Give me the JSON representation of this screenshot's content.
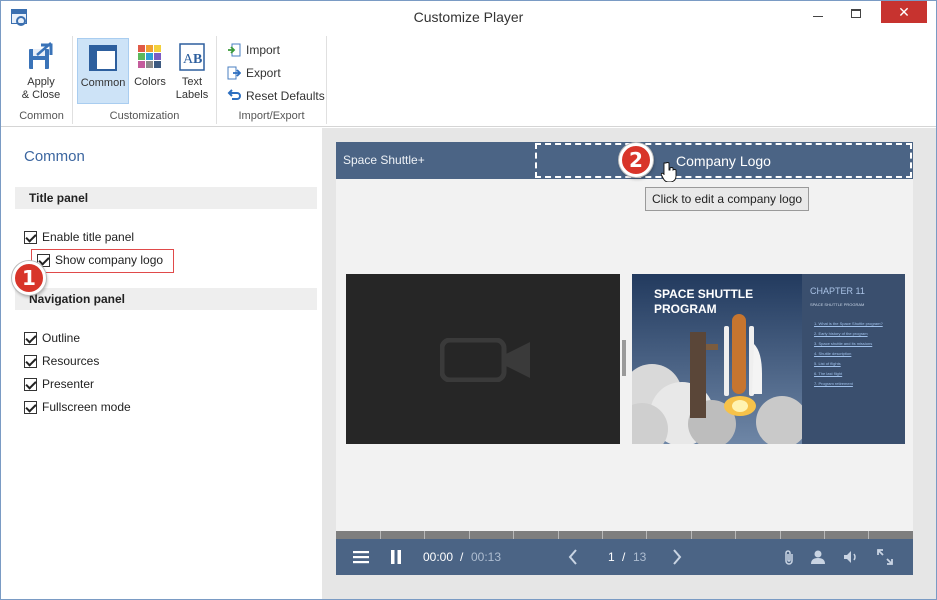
{
  "window": {
    "title": "Customize Player"
  },
  "ribbon": {
    "groups": [
      {
        "label": "Common"
      },
      {
        "label": "Customization"
      },
      {
        "label": "Import/Export"
      }
    ],
    "apply_close": {
      "line1": "Apply",
      "line2": "& Close"
    },
    "common": {
      "label": "Common"
    },
    "colors": {
      "label": "Colors"
    },
    "text_labels": {
      "line1": "Text",
      "line2": "Labels"
    },
    "import": {
      "label": "Import"
    },
    "export": {
      "label": "Export"
    },
    "reset": {
      "label": "Reset Defaults"
    }
  },
  "left": {
    "title": "Common",
    "title_panel": {
      "header": "Title panel",
      "enable": "Enable title panel",
      "show_logo": "Show company logo"
    },
    "navigation_panel": {
      "header": "Navigation panel",
      "items": [
        "Outline",
        "Resources",
        "Presenter",
        "Fullscreen mode"
      ]
    },
    "badge1": "1"
  },
  "preview": {
    "course_title": "Space Shuttle+",
    "logo_text": "Company Logo",
    "tooltip": "Click to edit a company logo",
    "badge2": "2",
    "slide": {
      "heading_line1": "SPACE SHUTTLE",
      "heading_line2": "PROGRAM",
      "chapter": "CHAPTER 11",
      "chapter_sub": "SPACE SHUTTLE PROGRAM",
      "links": [
        "1. What is the Space Shuttle program?",
        "2. Early history of the program",
        "3. Space shuttle and its missions",
        "4. Shuttle description",
        "5. List of flights",
        "6. The last flight",
        "7. Program retirement"
      ]
    },
    "controls": {
      "time_current": "00:00",
      "time_sep": "/",
      "time_total": "00:13",
      "page_current": "1",
      "page_sep": "/",
      "page_total": "13"
    }
  },
  "colors": {
    "accent": "#4b6485",
    "badge": "#d8352a",
    "title_link": "#3c66a0"
  }
}
